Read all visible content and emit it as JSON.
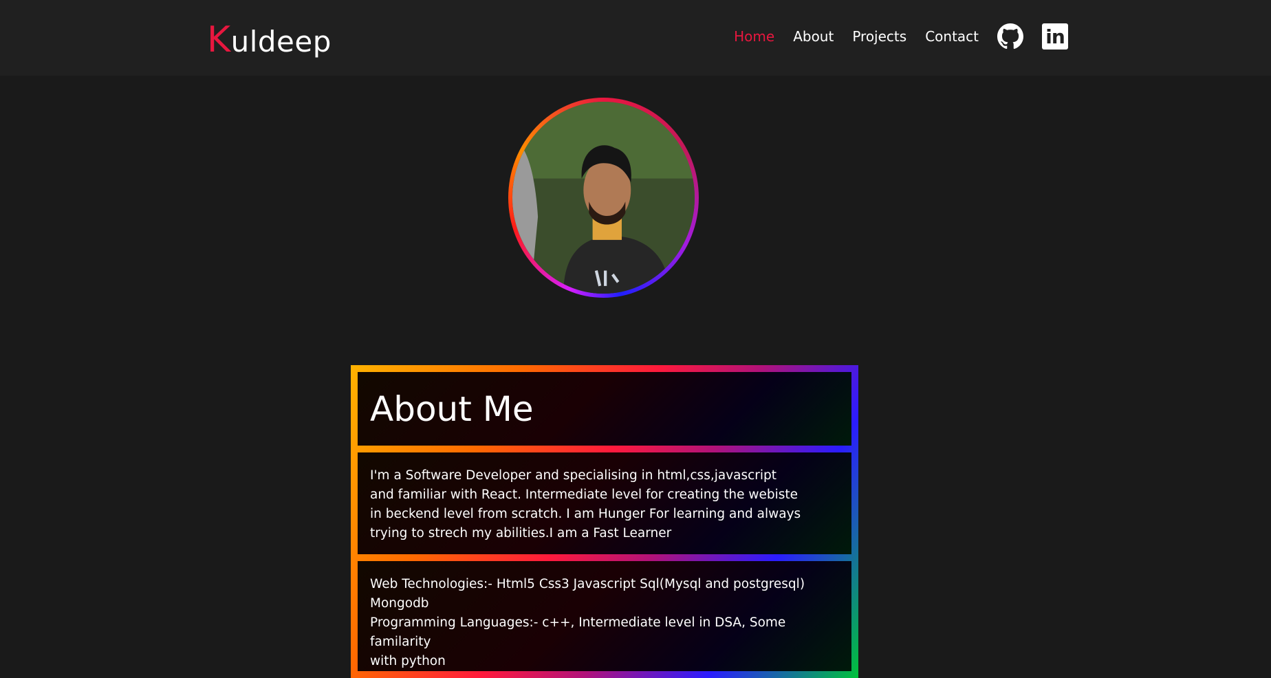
{
  "nav": {
    "logo_initial": "K",
    "logo_rest": "uldeep",
    "links": [
      "Home",
      "About",
      "Projects",
      "Contact"
    ],
    "active": "Home",
    "icons": [
      "github-icon",
      "linkedin-icon"
    ],
    "linkedin_text": "in"
  },
  "colors": {
    "accent": "#e8173f",
    "background": "#1a1a1a",
    "navbar": "#202020"
  },
  "about": {
    "title": "About Me",
    "bio": "I'm a Software Developer and specialising in html,css,javascript\nand familiar with React. Intermediate level for creating the webiste\nin beckend level from scratch. I am Hunger For learning and always\ntrying to strech my abilities.I am a Fast Learner",
    "skills": "Web Technologies:- Html5 Css3 Javascript Sql(Mysql and postgresql)\nMongodb\nProgramming Languages:- c++, Intermediate level in DSA, Some familarity\nwith python"
  }
}
